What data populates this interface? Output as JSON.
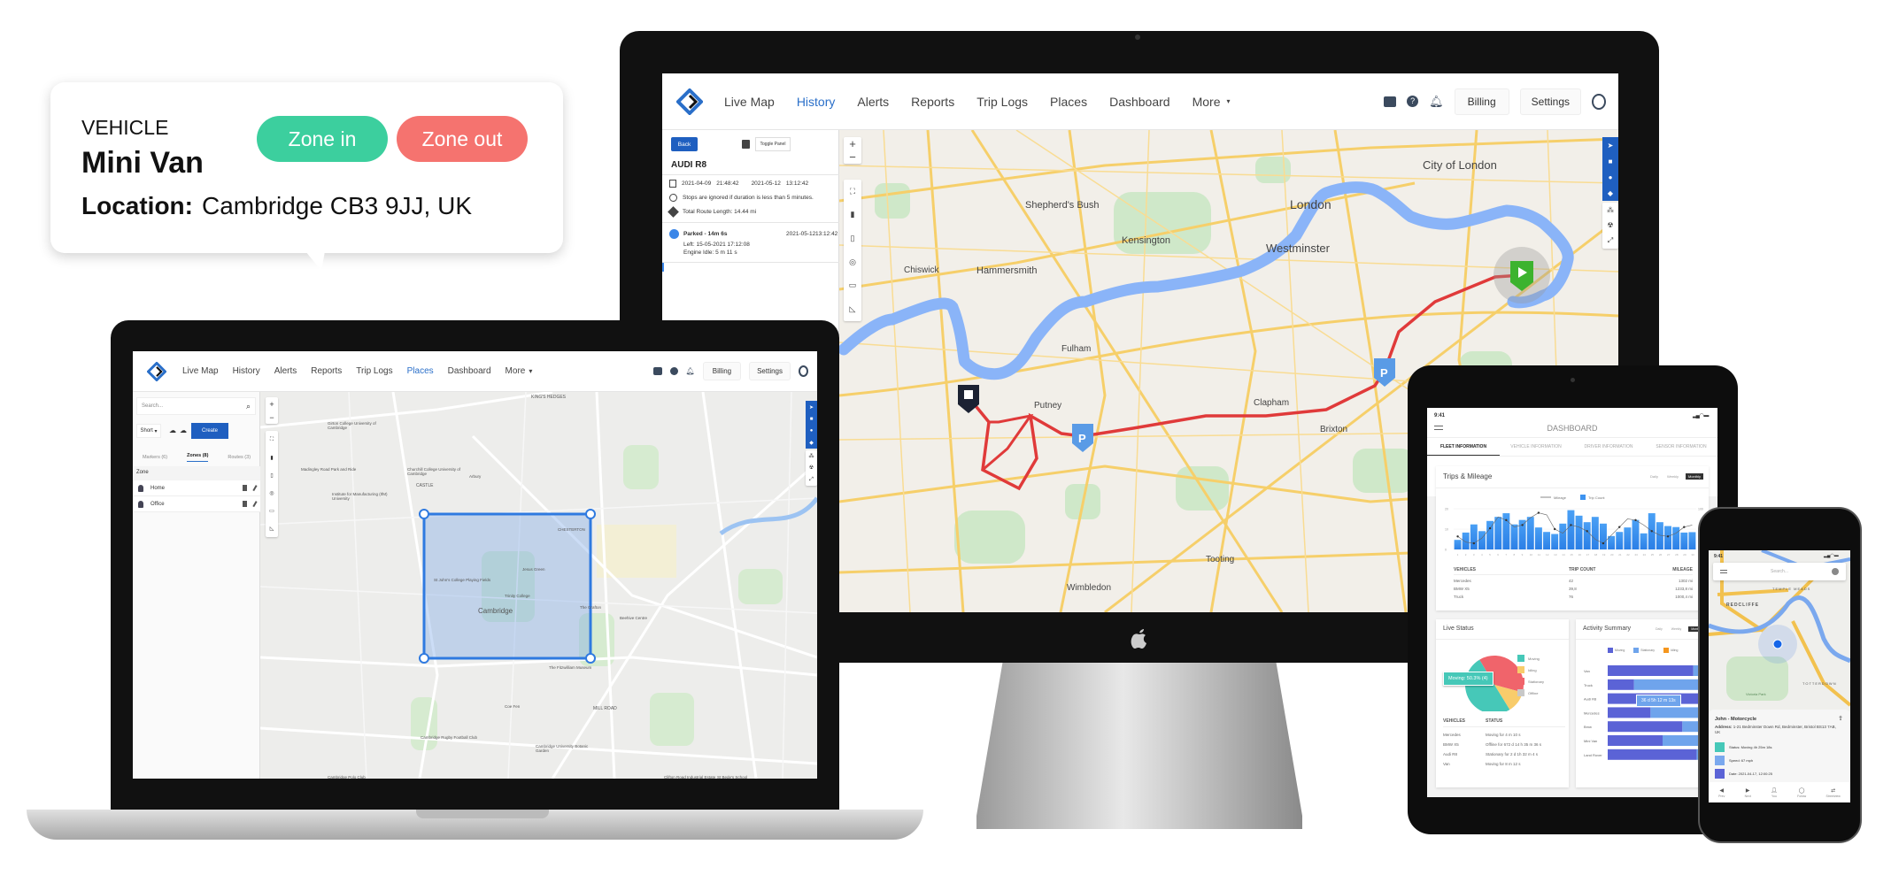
{
  "callout": {
    "label": "VEHICLE",
    "vehicle": "Mini Van",
    "location_label": "Location:",
    "location": "Cambridge CB3 9JJ, UK",
    "zone_in": "Zone in",
    "zone_out": "Zone out",
    "colors": {
      "zone_in": "#3ccf9e",
      "zone_out": "#f5736f"
    }
  },
  "nav": {
    "items": [
      "Live Map",
      "History",
      "Alerts",
      "Reports",
      "Trip Logs",
      "Places",
      "Dashboard",
      "More"
    ],
    "billing": "Billing",
    "settings": "Settings",
    "icons": [
      "chat-icon",
      "help-icon",
      "bell-icon",
      "user-avatar-icon"
    ],
    "accent": "#2a6fc9"
  },
  "monitor": {
    "active_tab": "History",
    "panel": {
      "back": "Back",
      "toggle_panel": "Toggle Panel",
      "vehicle": "AUDI R8",
      "start_date": "2021-04-09",
      "start_time": "21:48:42",
      "end_date": "2021-05-12",
      "end_time": "13:12:42",
      "stops_note": "Stops are ignored if duration is less than 5 minutes.",
      "route_length": "Total Route Length: 14.44 mi",
      "event": {
        "title": "Parked - 14m 6s",
        "date": "2021-05-12",
        "time": "13:12:42",
        "left": "Left: 15-05-2021 17:12:08",
        "idle": "Engine Idle: 5 m 11 s"
      }
    },
    "map_labels": [
      "City of London",
      "London",
      "Westminster",
      "Kensington",
      "Shepherd's Bush",
      "Chiswick",
      "Hammersmith",
      "Fulham",
      "Putney",
      "Clapham",
      "Brixton",
      "Tooting",
      "Wimbledon"
    ],
    "route_color": "#e03a3a",
    "parking_marker": "P"
  },
  "laptop": {
    "active_tab": "Places",
    "search_placeholder": "Search...",
    "sort": "Short",
    "create": "Create",
    "tabs": [
      "Markers (6)",
      "Zones (8)",
      "Routes (3)"
    ],
    "active_list_tab": "Zones (8)",
    "list_header": "Zone",
    "zones": [
      "Home",
      "Office"
    ],
    "map_labels": [
      "KING'S HEDGES",
      "Girton College University of Cambridge",
      "CASTLE",
      "Arbury",
      "CHESTERTON",
      "Cambridge American Cemetery",
      "Madingley Road Park and Ride",
      "Churchill College University of Cambridge",
      "Institute for Manufacturing (IfM) University",
      "COTON",
      "St John's College Playing Fields",
      "Jesus Green",
      "Trinity College",
      "Cambridge",
      "The Grafton",
      "Beehive Centre",
      "The Fitzwilliam Museum",
      "MILL ROAD",
      "Coe Fen",
      "Cambridge Rugby Football Club",
      "Cambridge University Botanic Garden",
      "Cambridge Polo Club",
      "NEWTOWN",
      "GRANTCHESTER MEADOWS",
      "Clifton Road Industrial Estate",
      "Hills Road Sixth Form College",
      "Homerton College University of Cambridge",
      "St Bede's School",
      "Google"
    ]
  },
  "tablet": {
    "time": "9:41",
    "title": "DASHBOARD",
    "tabs": [
      "FLEET INFORMATION",
      "VEHICLE INFORMATION",
      "DRIVER INFORMATION",
      "SENSOR INFORMATION"
    ],
    "active_tab": "FLEET INFORMATION",
    "trips": {
      "title": "Trips & Mileage",
      "ranges": [
        "Daily",
        "Weekly",
        "Monthly"
      ],
      "active_range": "Monthly",
      "legend": [
        "Mileage",
        "Trip Count"
      ],
      "y_left_ticks": [
        "0",
        "10",
        "20"
      ],
      "y_right_ticks": [
        "0",
        "50",
        "100"
      ],
      "days": [
        1,
        2,
        3,
        4,
        5,
        6,
        7,
        8,
        9,
        10,
        11,
        12,
        13,
        14,
        15,
        16,
        17,
        18,
        19,
        20,
        21,
        22,
        23,
        24,
        25,
        26,
        27,
        28,
        29,
        30
      ],
      "trip_count": [
        4.7,
        8.3,
        12.3,
        9,
        14,
        16,
        17.8,
        12.3,
        14.5,
        16,
        10.8,
        8.6,
        7.6,
        12.7,
        19.3,
        16.6,
        13.4,
        16,
        12.7,
        6.6,
        8.6,
        10.8,
        14.5,
        7.9,
        17.8,
        13.4,
        11.5,
        11,
        8.3,
        8.5
      ],
      "mileage": [
        32,
        18,
        15,
        28,
        52,
        80,
        72,
        55,
        60,
        78,
        90,
        85,
        50,
        40,
        60,
        55,
        45,
        25,
        15,
        35,
        55,
        75,
        72,
        60,
        45,
        35,
        32,
        40,
        55,
        60
      ],
      "table_headers": [
        "VEHICLES",
        "TRIP COUNT",
        "MILEAGE"
      ],
      "rows": [
        [
          "Mercedes",
          "42",
          "1302 mi"
        ],
        [
          "BMW X5",
          "39,8",
          "1233,8 mi"
        ],
        [
          "Truck",
          "76",
          "1000,4 mi"
        ]
      ],
      "colors": {
        "bars": "#3d93f0",
        "line": "#555555"
      }
    },
    "live_status": {
      "title": "Live Status",
      "tooltip": "Moving: 50.3% (4)",
      "slices": [
        {
          "label": "Moving",
          "value": 50.3,
          "color": "#46c8b8"
        },
        {
          "label": "Idling",
          "value": 12,
          "color": "#f8cc6b"
        },
        {
          "label": "Stationary",
          "value": 37.7,
          "color": "#f0646b"
        },
        {
          "label": "Offline",
          "value": 0,
          "color": "#c8c8c8"
        }
      ],
      "table_headers": [
        "VEHICLES",
        "STATUS"
      ],
      "rows": [
        [
          "Mercedes",
          "Moving for 4 m 10 s"
        ],
        [
          "BMW X5",
          "Offline for 672 d 14 h 35 m 36 s"
        ],
        [
          "Audi R8",
          "Stationary for 2 d 1h 32 m 4 s"
        ],
        [
          "Van",
          "Moving for 8 m 12 s"
        ]
      ]
    },
    "activity": {
      "title": "Activity Summary",
      "ranges": [
        "Daily",
        "Weekly",
        "Monthly"
      ],
      "legend": [
        "Moving",
        "Stationary",
        "Idling"
      ],
      "colors": [
        "#5b63d6",
        "#6fa4ec",
        "#f5961e"
      ],
      "tooltip": "36 d 5h 12 m 13s",
      "vehicles": [
        "Van",
        "Truck",
        "Audi R8",
        "Mercedes",
        "Bmw",
        "Mini Van",
        "Land Rover"
      ],
      "moving": [
        78,
        24,
        90,
        39,
        68,
        50,
        81
      ],
      "stationary": [
        20,
        73,
        10,
        58,
        25,
        34,
        15
      ],
      "idling": [
        2,
        3,
        0,
        3,
        7,
        16,
        4
      ]
    }
  },
  "phone": {
    "time": "9:41",
    "search_placeholder": "Search...",
    "map_labels": [
      "TEMPLE MEADS",
      "REDCLIFFE",
      "TOTTERDOWN",
      "Victoria Park"
    ],
    "driver": "John - Motorcycle",
    "address_label": "Address:",
    "address": "1-21 Bedminster Down Rd, Bedminster, Bristol BS13 7AB, UK",
    "status": "Status: Moving 4h 25m 18s",
    "speed": "Speed: 67 mph",
    "date": "Date: 2021-04-17, 12:00:25",
    "bottom_nav": [
      "Prev",
      "Next",
      "You",
      "Follow",
      "Streetview"
    ]
  }
}
